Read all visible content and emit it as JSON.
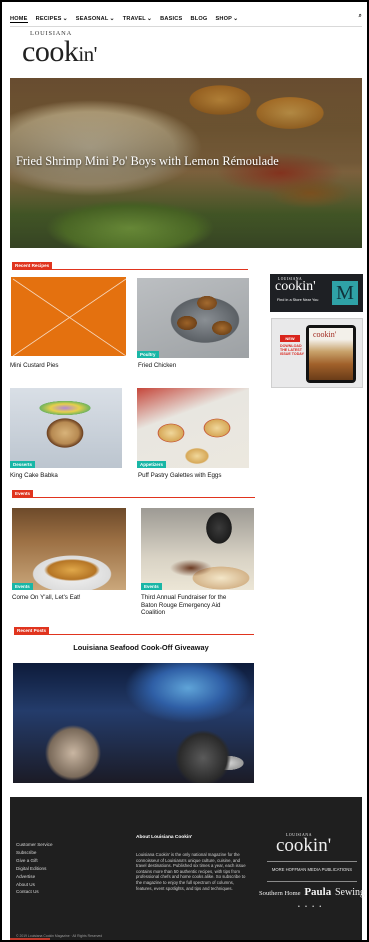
{
  "nav": {
    "items": [
      {
        "label": "HOME",
        "chevron": false
      },
      {
        "label": "RECIPES",
        "chevron": true
      },
      {
        "label": "SEASONAL",
        "chevron": true
      },
      {
        "label": "TRAVEL",
        "chevron": true
      },
      {
        "label": "BASICS",
        "chevron": false
      },
      {
        "label": "BLOG",
        "chevron": false
      },
      {
        "label": "SHOP",
        "chevron": true
      }
    ],
    "chevron_glyph": "⌄",
    "search_glyph": "⌕"
  },
  "logo": {
    "small": "LOUISIANA",
    "big_a": "cook",
    "big_b": "in'"
  },
  "hero": {
    "title": "Fried Shrimp Mini Po' Boys with Lemon Rémoulade"
  },
  "sections": {
    "recent_recipes": "Recent Recipes",
    "events": "Events",
    "recent_posts": "Recent Posts"
  },
  "recipes": [
    {
      "title": "Mini Custard Pies",
      "tag": ""
    },
    {
      "title": "Fried Chicken",
      "tag": "Poultry"
    },
    {
      "title": "King Cake Babka",
      "tag": "Desserts"
    },
    {
      "title": "Puff Pastry Galettes with Eggs",
      "tag": "Appetizers"
    }
  ],
  "events": [
    {
      "title": "Come On Y'all, Let's Eat!",
      "tag": "Events"
    },
    {
      "title_lines": [
        "Third Annual Fundraiser for the",
        "Baton Rouge Emergency Aid",
        "Coalition"
      ],
      "tag": "Events"
    }
  ],
  "featured_post": {
    "title": "Louisiana Seafood Cook-Off Giveaway"
  },
  "ads": {
    "store": {
      "small": "LOUISIANA",
      "big": "cookin'",
      "tagline": "Find in a Store Near You",
      "badge": "M"
    },
    "tablet": {
      "badge": "NEW",
      "copy": "DOWNLOAD THE LATEST ISSUE TODAY",
      "screen": "cookin'"
    }
  },
  "footer": {
    "links": [
      "Customer Service",
      "Subscribe",
      "Give a Gift",
      "Digital Editions",
      "Advertise",
      "About Us",
      "Contact Us"
    ],
    "about_heading": "About Louisiana Cookin'",
    "about_text": "Louisiana Cookin' is the only national magazine for the connoisseur of Louisiana's unique culture, cuisine, and travel destinations. Published six times a year, each issue contains more than 50 authentic recipes, with tips from professional chefs and home cooks alike. So subscribe to the magazine to enjoy the full spectrum of columns, features, event spotlights, and tips and techniques.",
    "logo_small": "LOUISIANA",
    "logo_big": "cookin'",
    "more_text": "MORE HOFFMAN MEDIA PUBLICATIONS",
    "brands": [
      "Southern Home",
      "Paula",
      "Sewing"
    ],
    "dots": "• • • •",
    "copyright": "© 2019 Louisiana Cookin Magazine · All Rights Reserved"
  }
}
